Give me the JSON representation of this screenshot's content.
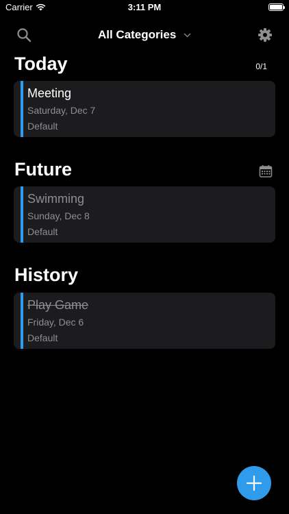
{
  "status": {
    "carrier": "Carrier",
    "time": "3:11 PM",
    "battery_level": 1.0
  },
  "header": {
    "title": "All Categories"
  },
  "sections": {
    "today": {
      "title": "Today",
      "count": "0/1",
      "task": {
        "name": "Meeting",
        "date": "Saturday, Dec 7",
        "category": "Default"
      }
    },
    "future": {
      "title": "Future",
      "task": {
        "name": "Swimming",
        "date": "Sunday, Dec 8",
        "category": "Default"
      }
    },
    "history": {
      "title": "History",
      "task": {
        "name": "Play Game",
        "date": "Friday, Dec 6",
        "category": "Default",
        "completed": true
      }
    }
  },
  "colors": {
    "accent": "#2f9bea",
    "card": "#1c1c1e",
    "secondary_text": "#8e8e93"
  },
  "icons": [
    "wifi-icon",
    "battery-icon",
    "search-icon",
    "chevron-down-icon",
    "gear-icon",
    "calendar-icon",
    "plus-icon"
  ]
}
